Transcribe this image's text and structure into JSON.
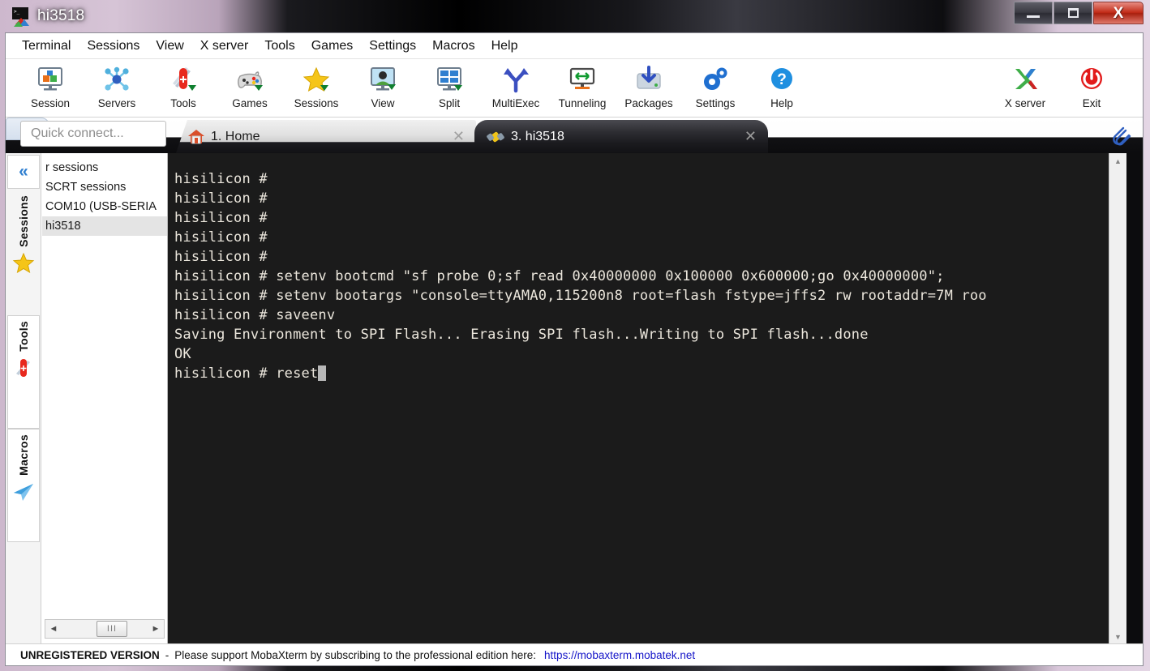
{
  "window": {
    "title": "hi3518",
    "icon": "mobaxterm-icon",
    "buttons": {
      "minimize": "minimize-button",
      "maximize": "maximize-button",
      "close_label": "X"
    }
  },
  "menubar": {
    "items": [
      {
        "label": "Terminal",
        "name": "menu-terminal"
      },
      {
        "label": "Sessions",
        "name": "menu-sessions"
      },
      {
        "label": "View",
        "name": "menu-view"
      },
      {
        "label": "X server",
        "name": "menu-x-server"
      },
      {
        "label": "Tools",
        "name": "menu-tools"
      },
      {
        "label": "Games",
        "name": "menu-games"
      },
      {
        "label": "Settings",
        "name": "menu-settings"
      },
      {
        "label": "Macros",
        "name": "menu-macros"
      },
      {
        "label": "Help",
        "name": "menu-help"
      }
    ]
  },
  "toolbar": {
    "left": [
      {
        "label": "Session",
        "icon": "session-icon"
      },
      {
        "label": "Servers",
        "icon": "servers-icon"
      },
      {
        "label": "Tools",
        "icon": "tools-icon"
      },
      {
        "label": "Games",
        "icon": "games-icon"
      },
      {
        "label": "Sessions",
        "icon": "sessions-star-icon"
      },
      {
        "label": "View",
        "icon": "view-icon"
      },
      {
        "label": "Split",
        "icon": "split-icon"
      },
      {
        "label": "MultiExec",
        "icon": "multiexec-icon"
      },
      {
        "label": "Tunneling",
        "icon": "tunneling-icon"
      },
      {
        "label": "Packages",
        "icon": "packages-icon"
      },
      {
        "label": "Settings",
        "icon": "settings-gear-icon"
      },
      {
        "label": "Help",
        "icon": "help-icon"
      }
    ],
    "right": [
      {
        "label": "X server",
        "icon": "x-server-icon"
      },
      {
        "label": "Exit",
        "icon": "exit-power-icon"
      }
    ]
  },
  "quick_connect": {
    "placeholder": "Quick connect...",
    "value": ""
  },
  "tabs": [
    {
      "label": "1. Home",
      "icon": "home-icon",
      "active": false,
      "closable": true
    },
    {
      "label": "3. hi3518",
      "icon": "serial-plug-icon",
      "active": true,
      "closable": true
    }
  ],
  "tab_add_label": "+",
  "sidebar": {
    "collapse_label": "«",
    "vertical_tabs": [
      {
        "label": "Sessions",
        "icon": "star-icon",
        "active": true
      },
      {
        "label": "Tools",
        "icon": "swiss-knife-icon",
        "active": false
      },
      {
        "label": "Macros",
        "icon": "paper-plane-icon",
        "active": false
      }
    ],
    "tree_items": [
      {
        "label": "r sessions",
        "selected": false
      },
      {
        "label": "SCRT sessions",
        "selected": false
      },
      {
        "label": "COM10  (USB-SERIA",
        "selected": false
      },
      {
        "label": "hi3518",
        "selected": true
      }
    ],
    "hscroll": {
      "left_arrow": "◄",
      "right_arrow": "►",
      "thumb": "III"
    }
  },
  "terminal": {
    "lines": [
      "hisilicon # ",
      "hisilicon # ",
      "hisilicon # ",
      "hisilicon # ",
      "hisilicon # ",
      "hisilicon # setenv bootcmd \"sf probe 0;sf read 0x40000000 0x100000 0x600000;go 0x40000000\";",
      "hisilicon # setenv bootargs \"console=ttyAMA0,115200n8 root=flash fstype=jffs2 rw rootaddr=7M roo",
      "hisilicon # saveenv",
      "Saving Environment to SPI Flash... Erasing SPI flash...Writing to SPI flash...done",
      "OK"
    ],
    "prompt_line": "hisilicon # reset",
    "cursor_visible": true,
    "bg_color": "#1b1b1b",
    "fg_color": "#ece7dd",
    "scroll": {
      "up_arrow": "▲",
      "down_arrow": "▼"
    }
  },
  "statusbar": {
    "strong": "UNREGISTERED VERSION",
    "separator": "-",
    "message": "Please support MobaXterm by subscribing to the professional edition here:",
    "link": "https://mobaxterm.mobatek.net",
    "link_color": "#1414c8"
  }
}
